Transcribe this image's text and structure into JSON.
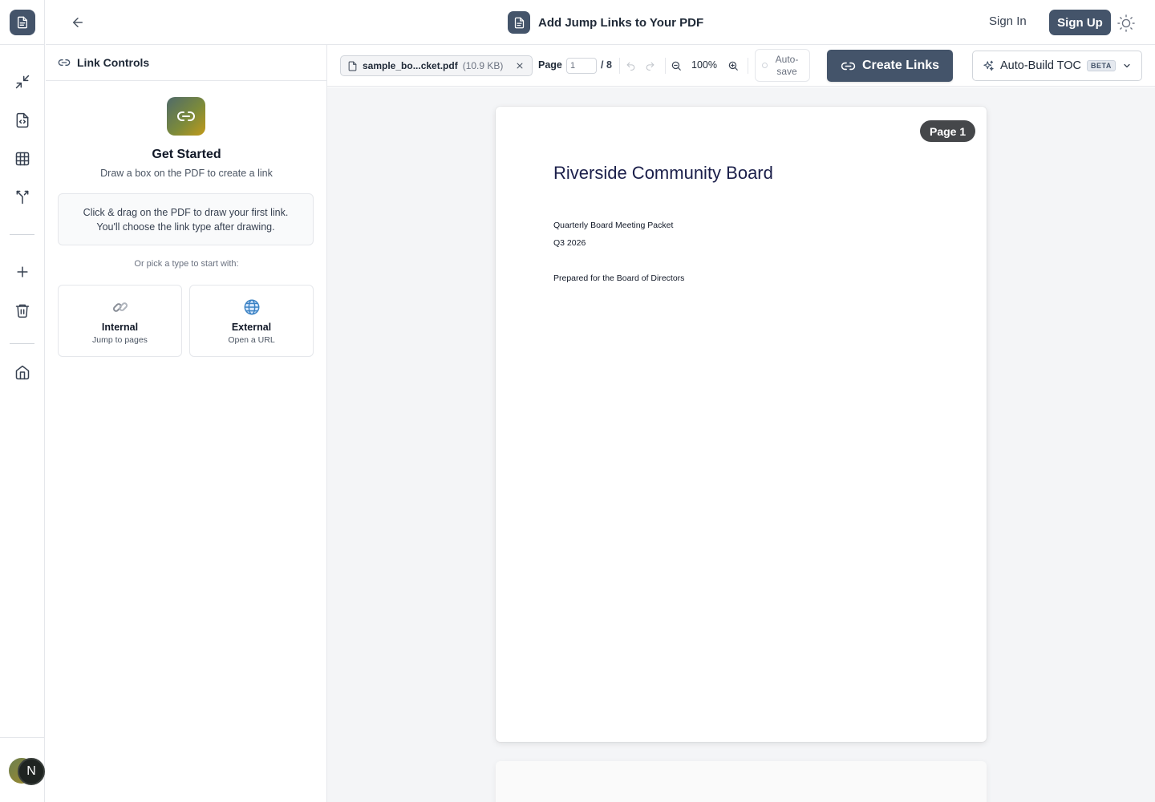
{
  "header": {
    "title": "Add Jump Links to Your PDF",
    "sign_in": "Sign In",
    "sign_up": "Sign Up"
  },
  "rail": {
    "avatar_initial": "N",
    "items": [
      "compress-icon",
      "code-file-icon",
      "grid-icon",
      "merge-icon",
      "plus-icon",
      "trash-icon",
      "home-icon"
    ]
  },
  "panel": {
    "title": "Link Controls",
    "get_started_title": "Get Started",
    "get_started_sub": "Draw a box on the PDF to create a link",
    "hint_line1": "Click & drag on the PDF to draw your first link.",
    "hint_line2": "You'll choose the link type after drawing.",
    "pick_label": "Or pick a type to start with:",
    "types": [
      {
        "title": "Internal",
        "sub": "Jump to pages",
        "icon": "chain-link-icon"
      },
      {
        "title": "External",
        "sub": "Open a URL",
        "icon": "globe-icon"
      }
    ]
  },
  "toolbar": {
    "file_name": "sample_bo...cket.pdf",
    "file_size": "(10.9 KB)",
    "page_label": "Page",
    "page_value": "1",
    "page_total": "/ 8",
    "zoom": "100%",
    "autosave": "Auto-save",
    "create_links": "Create Links",
    "toc_label": "Auto-Build TOC",
    "toc_badge": "BETA"
  },
  "document": {
    "page_badge": "Page 1",
    "title": "Riverside Community Board",
    "line1": "Quarterly Board Meeting Packet",
    "line2": "Q3 2026",
    "line3": "Prepared for the Board of Directors"
  },
  "colors": {
    "accent": "#44546a",
    "canvas_bg": "#f4f5f7",
    "doc_title": "#1b1f4a"
  }
}
